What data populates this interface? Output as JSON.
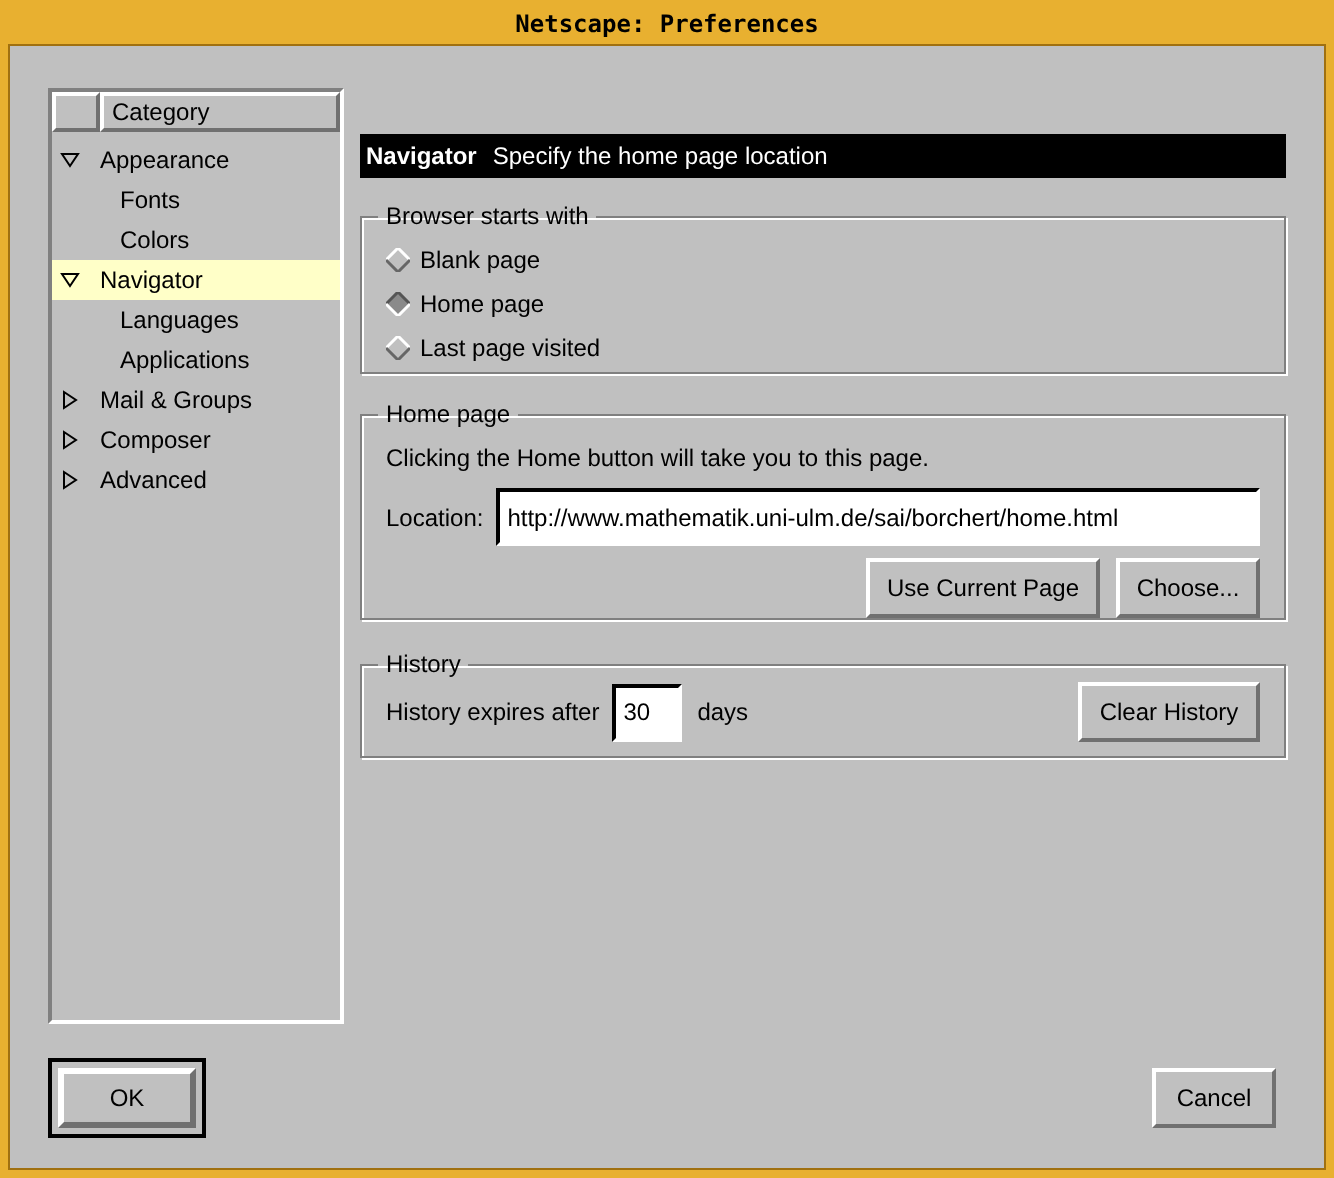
{
  "window": {
    "title": "Netscape: Preferences"
  },
  "sidebar": {
    "header": "Category",
    "items": [
      {
        "label": "Appearance",
        "expanded": true,
        "selected": false,
        "children": [
          {
            "label": "Fonts",
            "selected": false
          },
          {
            "label": "Colors",
            "selected": false
          }
        ]
      },
      {
        "label": "Navigator",
        "expanded": true,
        "selected": true,
        "children": [
          {
            "label": "Languages",
            "selected": false
          },
          {
            "label": "Applications",
            "selected": false
          }
        ]
      },
      {
        "label": "Mail & Groups",
        "expanded": false,
        "selected": false
      },
      {
        "label": "Composer",
        "expanded": false,
        "selected": false
      },
      {
        "label": "Advanced",
        "expanded": false,
        "selected": false
      }
    ]
  },
  "panel_header": {
    "title": "Navigator",
    "subtitle": "Specify the home page location"
  },
  "browser_starts_with": {
    "legend": "Browser starts with",
    "options": [
      {
        "label": "Blank page",
        "selected": false
      },
      {
        "label": "Home page",
        "selected": true
      },
      {
        "label": "Last page visited",
        "selected": false
      }
    ]
  },
  "home_page": {
    "legend": "Home page",
    "description": "Clicking the Home button will take you to this page.",
    "location_label": "Location:",
    "location_value": "http://www.mathematik.uni-ulm.de/sai/borchert/home.html",
    "buttons": [
      "Use Current Page",
      "Choose..."
    ]
  },
  "history": {
    "legend": "History",
    "label_before": "History expires after",
    "days_value": "30",
    "label_after": "days",
    "button": "Clear History"
  },
  "buttons": [
    {
      "label": "OK",
      "default": true
    },
    {
      "label": "Cancel",
      "default": false
    }
  ]
}
